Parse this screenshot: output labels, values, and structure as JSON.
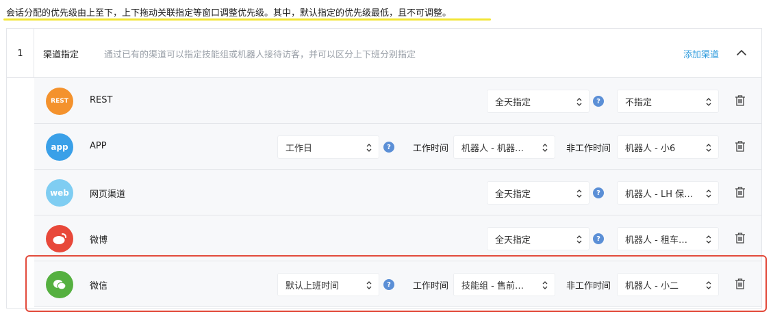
{
  "notice": "会话分配的优先级由上至下，上下拖动关联指定等窗口调整优先级。其中，默认指定的优先级最低，且不可调整。",
  "group": {
    "index": "1",
    "title": "渠道指定",
    "description": "通过已有的渠道可以指定技能组或机器人接待访客，并可以区分上下班分别指定",
    "add_label": "添加渠道"
  },
  "colors": {
    "rest": "#f4922d",
    "app": "#3aa0e8",
    "web": "#7fcdf2",
    "weibo": "#e8483a",
    "wechat": "#55b040",
    "highlight": "#e24a3b",
    "link": "#2e9bdc"
  },
  "rows": [
    {
      "icon_text": "REST",
      "icon": "rest-icon",
      "name": "REST",
      "mode": "全天指定",
      "target": "不指定"
    },
    {
      "icon_text": "app",
      "icon": "app-icon",
      "name": "APP",
      "mode": "工作日",
      "work_label": "工作时间",
      "work_target": "机器人 - 机器…",
      "off_label": "非工作时间",
      "off_target": "机器人 - 小6"
    },
    {
      "icon_text": "web",
      "icon": "web-icon",
      "name": "网页渠道",
      "mode": "全天指定",
      "target": "机器人 - LH 保…"
    },
    {
      "icon": "weibo-icon",
      "name": "微博",
      "mode": "全天指定",
      "target": "机器人 - 租车…"
    },
    {
      "icon": "wechat-icon",
      "name": "微信",
      "mode": "默认上班时间",
      "work_label": "工作时间",
      "work_target": "技能组 - 售前…",
      "off_label": "非工作时间",
      "off_target": "机器人 - 小二"
    }
  ]
}
